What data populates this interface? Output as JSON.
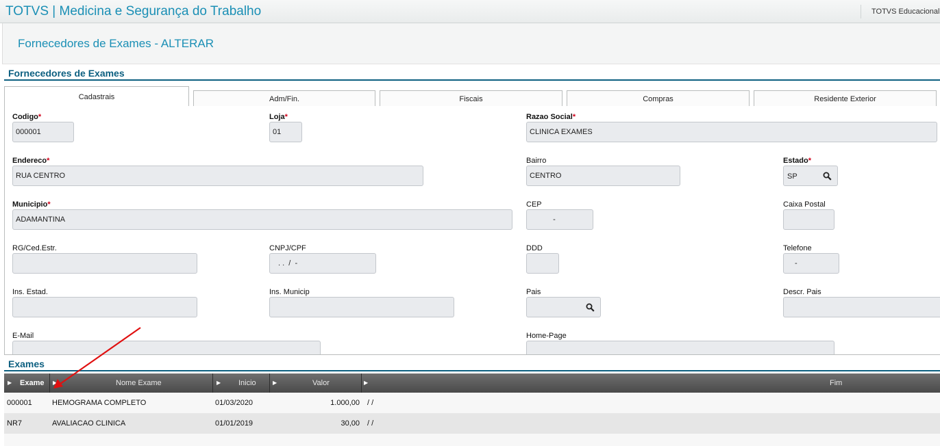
{
  "app": {
    "title": "TOTVS | Medicina e Segurança do Trabalho",
    "brand": "TOTVS Educacional"
  },
  "page": {
    "title": "Fornecedores de Exames - ALTERAR"
  },
  "sections": {
    "main": "Fornecedores de Exames",
    "exams": "Exames"
  },
  "tabs": [
    {
      "label": "Cadastrais",
      "active": true
    },
    {
      "label": "Adm/Fin.",
      "active": false
    },
    {
      "label": "Fiscais",
      "active": false
    },
    {
      "label": "Compras",
      "active": false
    },
    {
      "label": "Residente Exterior",
      "active": false
    }
  ],
  "form": {
    "codigo": {
      "label": "Codigo",
      "required": true,
      "value": "000001"
    },
    "loja": {
      "label": "Loja",
      "required": true,
      "value": "01"
    },
    "razao_social": {
      "label": "Razao Social",
      "required": true,
      "value": "CLINICA EXAMES"
    },
    "endereco": {
      "label": "Endereco",
      "required": true,
      "value": "RUA CENTRO"
    },
    "bairro": {
      "label": "Bairro",
      "required": false,
      "value": "CENTRO"
    },
    "estado": {
      "label": "Estado",
      "required": true,
      "value": "SP"
    },
    "municipio": {
      "label": "Municipio",
      "required": true,
      "value": "ADAMANTINA"
    },
    "cep": {
      "label": "CEP",
      "required": false,
      "value": "-"
    },
    "caixa_postal": {
      "label": "Caixa Postal",
      "required": false,
      "value": ""
    },
    "rg": {
      "label": "RG/Ced.Estr.",
      "required": false,
      "value": ""
    },
    "cnpj": {
      "label": "CNPJ/CPF",
      "required": false,
      "value": ". .  /  -"
    },
    "ddd": {
      "label": "DDD",
      "required": false,
      "value": ""
    },
    "telefone": {
      "label": "Telefone",
      "required": false,
      "value": "-"
    },
    "ins_estad": {
      "label": "Ins. Estad.",
      "required": false,
      "value": ""
    },
    "ins_municip": {
      "label": "Ins. Municip",
      "required": false,
      "value": ""
    },
    "pais": {
      "label": "Pais",
      "required": false,
      "value": ""
    },
    "descr_pais": {
      "label": "Descr. Pais",
      "required": false,
      "value": ""
    },
    "email": {
      "label": "E-Mail",
      "required": false,
      "value": ""
    },
    "homepage": {
      "label": "Home-Page",
      "required": false,
      "value": ""
    }
  },
  "grid": {
    "columns": [
      "Exame",
      "Nome Exame",
      "Inicio",
      "Valor",
      "Fim"
    ],
    "rows": [
      {
        "exame": "000001",
        "nome": "HEMOGRAMA COMPLETO",
        "inicio": "01/03/2020",
        "valor": "1.000,00",
        "fim": "/ /"
      },
      {
        "exame": "NR7",
        "nome": "AVALIACAO CLINICA",
        "inicio": "01/01/2019",
        "valor": "30,00",
        "fim": "/ /"
      }
    ]
  },
  "icons": {
    "lookup": "magnifier-icon",
    "annotation": "red-arrow-annotation",
    "column_sort": "triangle-right-icon"
  },
  "colors": {
    "accent": "#1a8fb5",
    "section": "#0c5f80",
    "required": "#d0021b",
    "grid_header": "#4a4a4a",
    "annotation": "#e01010"
  }
}
